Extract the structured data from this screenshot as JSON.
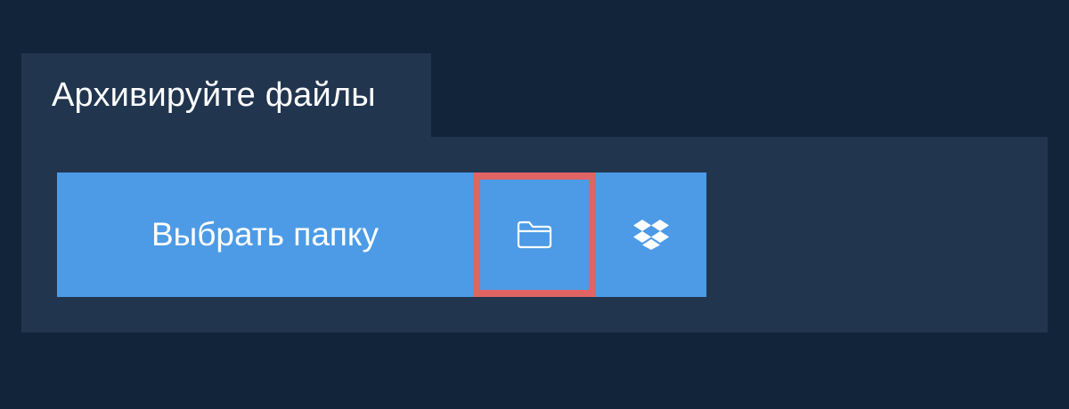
{
  "tab": {
    "title": "Архивируйте файлы"
  },
  "actions": {
    "choose_folder_label": "Выбрать папку",
    "folder_icon": "folder-icon",
    "dropbox_icon": "dropbox-icon"
  },
  "colors": {
    "page_background": "#12243a",
    "panel_background": "#21354f",
    "button_background": "#4d9be6",
    "highlight_border": "#e06464",
    "text": "#ffffff"
  }
}
